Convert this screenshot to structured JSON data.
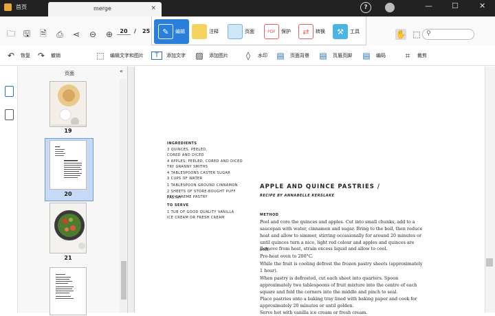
{
  "titlebar": {
    "home_label": "首页",
    "doc_tab_title": "merge",
    "help_glyph": "?",
    "close_tab_glyph": "×",
    "minimize_glyph": "—",
    "maximize_glyph": "☐",
    "close_window_glyph": "✕"
  },
  "toolbar": {
    "current_page": "20",
    "separator": "/",
    "total_pages": "25",
    "ribbon": [
      {
        "label": "编辑",
        "icon": "edit-icon",
        "color": "#ffffff"
      },
      {
        "label": "注释",
        "icon": "comment-icon",
        "color": "#f4d45c"
      },
      {
        "label": "页面",
        "icon": "page-icon",
        "color": "#6fb6e8"
      },
      {
        "label": "保护",
        "icon": "protect-icon",
        "color": "#e85c5c"
      },
      {
        "label": "转换",
        "icon": "convert-icon",
        "color": "#e85c5c"
      },
      {
        "label": "工具",
        "icon": "tools-icon",
        "color": "#4bb4e0"
      }
    ]
  },
  "edit_toolbar": {
    "restore": "恢复",
    "undo": "撤销",
    "edit_text_image": "编辑文字和图片",
    "add_text": "添加文字",
    "add_image": "添加图片",
    "watermark": "水印",
    "page_background": "页面背景",
    "header_footer": "页眉页脚",
    "bates": "编码",
    "crop": "裁剪"
  },
  "thumbnails": {
    "panel_title": "页面",
    "pages": [
      "19",
      "20",
      "21"
    ]
  },
  "document": {
    "ingredients_head": "INGREDIENTS",
    "ingredients": [
      "3 QUINCES, PEELED,",
      "CORED AND DICED",
      "4 APPLES, PEELED, CORED AND DICED",
      "TRY GRANNY SMITHS",
      "4 TABLESPOONS CASTER SUGAR",
      "3 CUPS OF WATER",
      "1 TABLESPOON GROUND CINNAMON",
      "2 SHEETS OF STORE-BOUGHT PUFF PASTRY",
      "TRY CAREME PASTRY"
    ],
    "serve_head": "TO SERVE",
    "serve": [
      "1 TUB OF GOOD QUALITY VANILLA",
      "ICE CREAM OR FRESH CREAM"
    ],
    "title": "APPLE AND QUINCE PASTRIES /",
    "byline": "RECIPE BY ANNABELLE KERSLAKE",
    "method_head": "METHOD",
    "method": [
      "Peel and core the quinces and apples. Cut into small chunks, add to a saucepan with water, cinnamon and sugar. Bring to the boil, then reduce heat and allow to simmer, stirring occasionally for around 20 minutes or until quinces turn a nice, light red colour and apples and quinces are soft.",
      "Remove from heat, strain excess liquid and allow to cool.",
      "Pre-heat oven to 200°C.",
      "While the fruit is cooling defrost the frozen pastry sheets (approximately 1 hour).",
      "When pastry is defrosted, cut each sheet into quarters. Spoon approximately two tablespoons of fruit mixture into the centre of each square and fold the corners into the middle and pinch to seal.",
      "Place pastries onto a baking tray lined with baking paper and cook for approximately 20 minutes or until golden.",
      "Serve hot with vanilla ice cream or fresh cream."
    ]
  }
}
